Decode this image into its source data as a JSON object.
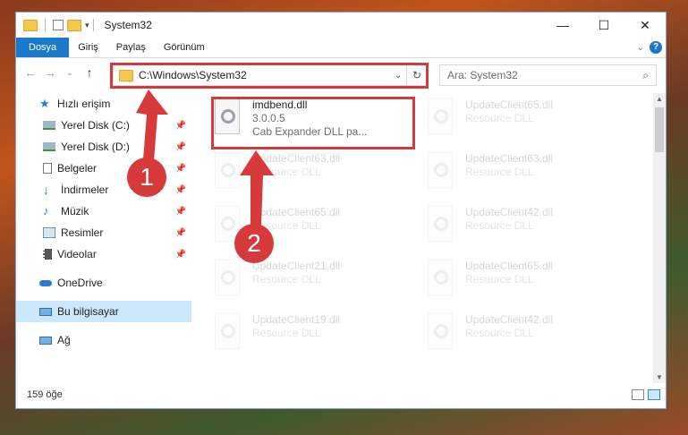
{
  "window": {
    "title": "System32",
    "controls": {
      "minimize": "—",
      "maximize": "☐",
      "close": "✕"
    }
  },
  "ribbon": {
    "tabs": [
      "Dosya",
      "Giriş",
      "Paylaş",
      "Görünüm"
    ],
    "help": "?"
  },
  "nav": {
    "back": "←",
    "forward": "→",
    "recent": "⌄",
    "up": "↑",
    "address": "C:\\Windows\\System32",
    "search_placeholder": "Ara: System32"
  },
  "sidebar": {
    "quick_access": "Hızlı erişim",
    "items": [
      {
        "label": "Yerel Disk (C:)",
        "icon": "drive-icon"
      },
      {
        "label": "Yerel Disk (D:)",
        "icon": "drive-icon"
      },
      {
        "label": "Belgeler",
        "icon": "documents-icon"
      },
      {
        "label": "İndirmeler",
        "icon": "download-icon"
      },
      {
        "label": "Müzik",
        "icon": "music-icon"
      },
      {
        "label": "Resimler",
        "icon": "pictures-icon"
      },
      {
        "label": "Videolar",
        "icon": "videos-icon"
      }
    ],
    "onedrive": "OneDrive",
    "this_pc": "Bu bilgisayar",
    "network": "Ağ"
  },
  "files": {
    "highlighted": {
      "name": "imdbend.dll",
      "version": "3.0.0.5",
      "description": "Cab Expander DLL pa..."
    },
    "left_column": [
      {
        "name": "UpdateClient63.dll",
        "type": "Resource DLL"
      },
      {
        "name": "UpdateClient65.dll",
        "type": "Resource DLL"
      },
      {
        "name": "UpdateClient21.dll",
        "type": "Resource DLL"
      },
      {
        "name": "UpdateClient19.dll",
        "type": "Resource DLL"
      }
    ],
    "right_column": [
      {
        "name": "UpdateClient65.dll",
        "type": "Resource DLL"
      },
      {
        "name": "UpdateClient63.dll",
        "type": "Resource DLL"
      },
      {
        "name": "UpdateClient42.dll",
        "type": "Resource DLL"
      },
      {
        "name": "UpdateClient65.dll",
        "type": "Resource DLL"
      },
      {
        "name": "UpdateClient42.dll",
        "type": "Resource DLL"
      }
    ]
  },
  "status": {
    "count": "159 öğe"
  },
  "annotations": {
    "step1": "1",
    "step2": "2",
    "color": "#d63a3a"
  }
}
